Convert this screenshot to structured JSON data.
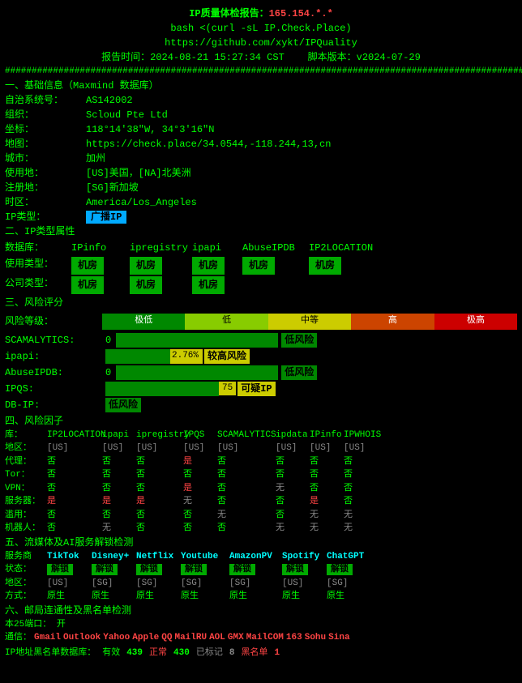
{
  "header": {
    "title_prefix": "IP质量体检报告：",
    "title_ip": "165.154.*.*",
    "cmd": "bash <(curl -sL IP.Check.Place)",
    "github": "https://github.com/xykt/IPQuality",
    "report_time_label": "报告时间：",
    "report_time": "2024-08-21 15:27:34 CST",
    "script_label": "脚本版本：",
    "script_ver": "v2024-07-29",
    "hash_line": "##############################################################################################################"
  },
  "section1": {
    "title": "一、基础信息（Maxmind 数据库）",
    "as_label": "自治系统号：",
    "as_val": "AS142002",
    "org_label": "组织：",
    "org_val": "Scloud Pte Ltd",
    "coord_label": "坐标：",
    "coord_val": "118°14'38\"W, 34°3'16\"N",
    "map_label": "地图：",
    "map_val": "https://check.place/34.0544,-118.244,13,cn",
    "city_label": "城市：",
    "city_val": "加州",
    "usage_label": "使用地：",
    "usage_val": "[US]美国，[NA]北美洲",
    "reg_label": "注册地：",
    "reg_val": "[SG]新加坡",
    "tz_label": "时区：",
    "tz_val": "America/Los_Angeles",
    "iptype_label": "IP类型：",
    "iptype_val": "广播IP"
  },
  "section2": {
    "title": "二、IP类型属性",
    "db_label": "数据库：",
    "db_ipinfo": "IPinfo",
    "db_ipregistry": "ipregistry",
    "db_ipapi": "ipapi",
    "db_abuseipdb": "AbuseIPDB",
    "db_ip2location": "IP2LOCATION",
    "usage_label": "使用类型：",
    "company_label": "公司类型：",
    "cells": [
      {
        "db": "IPinfo",
        "usage": "机房",
        "company": "机房"
      },
      {
        "db": "ipregistry",
        "usage": "机房",
        "company": "机房"
      },
      {
        "db": "ipapi",
        "usage": "机房",
        "company": "机房"
      },
      {
        "db": "AbuseIPDB",
        "usage": "机房",
        "company": null
      },
      {
        "db": "IP2LOCATION",
        "usage": "机房",
        "company": null
      }
    ]
  },
  "section3": {
    "title": "三、风险评分",
    "risk_levels": [
      "极低",
      "低",
      "中等",
      "高",
      "极高"
    ],
    "scamalytics_label": "SCAMALYTICS:",
    "scamalytics_val": "0",
    "scamalytics_tag": "低风险",
    "ipapi_label": "ipapi:",
    "ipapi_pct": "2.76%",
    "ipapi_tag": "较高风险",
    "abuseipdb_label": "AbuseIPDB:",
    "abuseipdb_val": "0",
    "abuseipdb_tag": "低风险",
    "ipqs_label": "IPQS:",
    "ipqs_val": "75",
    "ipqs_tag": "可疑IP",
    "dbip_label": "DB-IP:",
    "dbip_tag": "低风险"
  },
  "section4": {
    "title": "四、风险因子",
    "headers": [
      "库：",
      "IP2LOCATION",
      "ipapi",
      "ipregistry",
      "IPQS",
      "SCAMALYTICS",
      "ipdata",
      "IPinfo",
      "IPWHOIS"
    ],
    "region_label": "地区：",
    "regions": [
      "[US]",
      "[US]",
      "[US]",
      "[US]",
      "[US]",
      "[US]",
      "[US]",
      "[US]"
    ],
    "rows": [
      {
        "label": "代理：",
        "vals": [
          "否",
          "否",
          "否",
          "是",
          "否",
          "否",
          "否",
          "否"
        ]
      },
      {
        "label": "Tor：",
        "vals": [
          "否",
          "否",
          "否",
          "否",
          "否",
          "否",
          "否",
          "否"
        ]
      },
      {
        "label": "VPN：",
        "vals": [
          "否",
          "否",
          "否",
          "是",
          "否",
          "无",
          "否",
          "否"
        ]
      },
      {
        "label": "服务器：",
        "vals": [
          "是",
          "是",
          "是",
          "无",
          "否",
          "否",
          "是",
          "否"
        ]
      },
      {
        "label": "滥用：",
        "vals": [
          "否",
          "否",
          "否",
          "否",
          "无",
          "否",
          "无",
          "无"
        ]
      },
      {
        "label": "机器人：",
        "vals": [
          "否",
          "无",
          "否",
          "否",
          "否",
          "无",
          "无",
          "无"
        ]
      }
    ]
  },
  "section5": {
    "title": "五、流媒体及AI服务解锁检测",
    "services": [
      "TikTok",
      "Disney+",
      "Netflix",
      "Youtube",
      "AmazonPV",
      "Spotify",
      "ChatGPT"
    ],
    "status_label": "状态：",
    "statuses": [
      "解锁",
      "解锁",
      "解锁",
      "解锁",
      "解锁",
      "解锁",
      "解锁"
    ],
    "region_label": "地区：",
    "regions": [
      "[US]",
      "[SG]",
      "[SG]",
      "[SG]",
      "[SG]",
      "[US]",
      "[SG]"
    ],
    "method_label": "方式：",
    "methods": [
      "原生",
      "原生",
      "原生",
      "原生",
      "原生",
      "原生",
      "原生"
    ]
  },
  "section6": {
    "title": "六、邮局连通性及黑名单检测",
    "port_label": "本25端口：",
    "port_val": "开",
    "isp_label": "通信：",
    "isps": [
      "Gmail",
      "Outlook",
      "Yahoo",
      "Apple",
      "QQ",
      "MailRU",
      "AOL",
      "GMX",
      "MailCOM",
      "163",
      "Sohu",
      "Sina"
    ],
    "db_label": "IP地址黑名单数据库：",
    "valid_label": "有效",
    "valid_num": "439",
    "err_label": "正常",
    "err_num": "430",
    "marked_label": "已标记",
    "marked_num": "8",
    "block_label": "黑名单",
    "block_num": "1"
  }
}
